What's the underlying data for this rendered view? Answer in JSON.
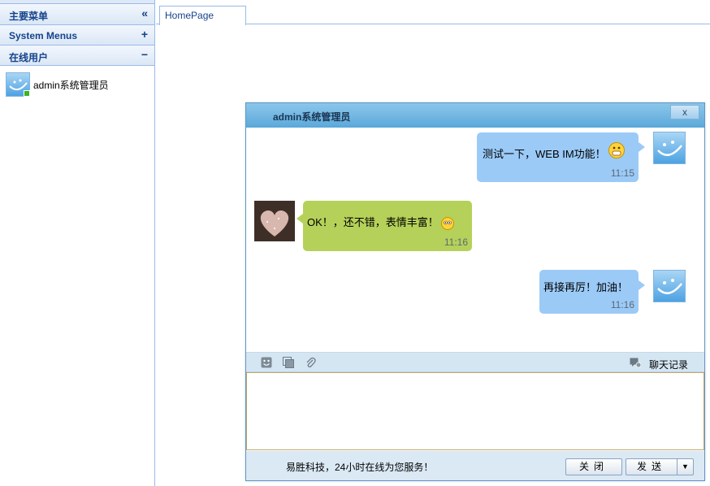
{
  "sidebar": {
    "panels": [
      {
        "title": "主要菜单",
        "tool": "«"
      },
      {
        "title": "System Menus",
        "tool": "+"
      },
      {
        "title": "在线用户",
        "tool": "−"
      }
    ],
    "online_users": [
      {
        "name": "admin系统管理员",
        "status": "online"
      }
    ]
  },
  "tabs": [
    {
      "label": "HomePage"
    }
  ],
  "chat": {
    "title": "admin系统管理员",
    "close_label": "x",
    "messages": [
      {
        "side": "right",
        "text": "测试一下，WEB IM功能！",
        "emoji": "grin-emoji",
        "time": "11:15"
      },
      {
        "side": "left",
        "text": "OK！，还不错，表情丰富！",
        "emoji": "shy-emoji",
        "time": "11:16"
      },
      {
        "side": "right",
        "text": "再接再厉！加油！",
        "emoji": "",
        "time": "11:16"
      }
    ],
    "toolbar": {
      "history_label": "聊天记录"
    },
    "input_value": "",
    "footer_text": "易胜科技，24小时在线为您服务！",
    "close_button": "关闭",
    "send_button": "发送",
    "send_dropdown": "▼"
  },
  "colors": {
    "panel_border": "#99bbe8",
    "header_text": "#15428b",
    "bubble_self": "#9bcaf7",
    "bubble_other": "#b5d159",
    "online_status": "#3cb521"
  }
}
